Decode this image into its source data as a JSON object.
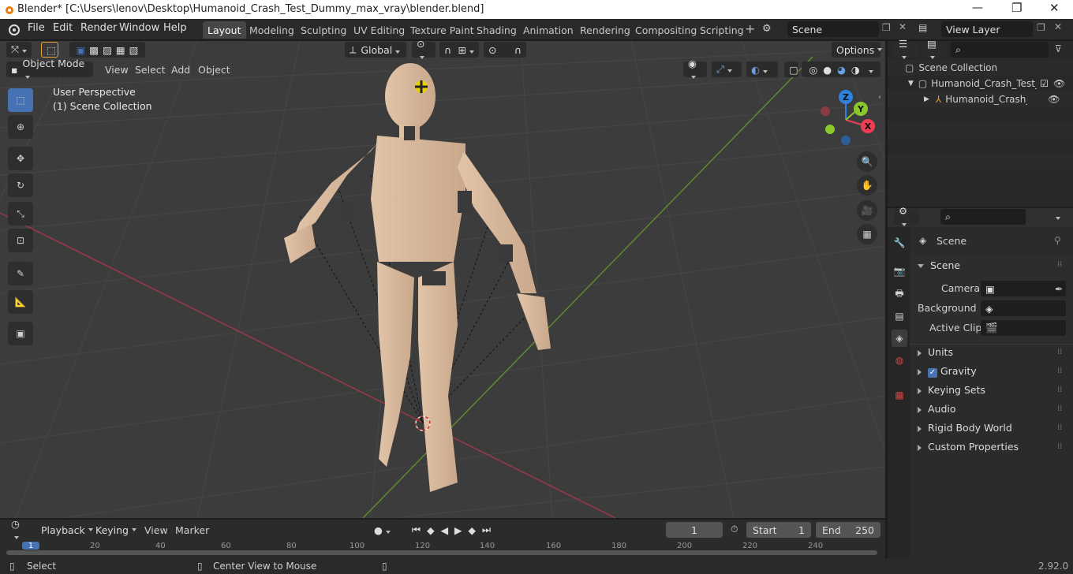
{
  "window": {
    "title": "Blender* [C:\\Users\\lenov\\Desktop\\Humanoid_Crash_Test_Dummy_max_vray\\blender.blend]",
    "controls": [
      "—",
      "❐",
      "✕"
    ]
  },
  "menus": [
    "File",
    "Edit",
    "Render",
    "Window",
    "Help"
  ],
  "workspace_tabs": [
    "Layout",
    "Modeling",
    "Sculpting",
    "UV Editing",
    "Texture Paint",
    "Shading",
    "Animation",
    "Rendering",
    "Compositing",
    "Scripting"
  ],
  "active_tab": "Layout",
  "scene_field": "Scene",
  "view_layer_field": "View Layer",
  "viewport": {
    "transform_orientation": "Global",
    "options_label": "Options",
    "mode": "Object Mode",
    "header_menus": [
      "View",
      "Select",
      "Add",
      "Object"
    ],
    "overlay_text_1": "User Perspective",
    "overlay_text_2": "(1) Scene Collection",
    "gizmo_axes": {
      "x": "X",
      "y": "Y",
      "z": "Z"
    },
    "axis_colors": {
      "x": "#f03c52",
      "y": "#8ac82c",
      "z": "#2e82e0"
    }
  },
  "outliner": {
    "root": "Scene Collection",
    "items": [
      "Humanoid_Crash_Test_D",
      "Humanoid_Crash_Tes"
    ]
  },
  "properties": {
    "header": "Scene",
    "panel_scene": "Scene",
    "camera_label": "Camera",
    "background_label": "Background ...",
    "active_clip_label": "Active Clip",
    "panels": [
      "Units",
      "Gravity",
      "Keying Sets",
      "Audio",
      "Rigid Body World",
      "Custom Properties"
    ],
    "gravity_checked": true
  },
  "timeline": {
    "menus": [
      "Playback",
      "Keying",
      "View",
      "Marker"
    ],
    "current_frame": "1",
    "start_label": "Start",
    "start_value": "1",
    "end_label": "End",
    "end_value": "250",
    "ruler": [
      "1",
      "20",
      "40",
      "60",
      "80",
      "100",
      "120",
      "140",
      "160",
      "180",
      "200",
      "220",
      "240"
    ]
  },
  "status": {
    "left": "Select",
    "middle": "Center View to Mouse",
    "version": "2.92.0"
  },
  "colors": {
    "accent": "#4772b3",
    "active_tab": "#464646"
  }
}
